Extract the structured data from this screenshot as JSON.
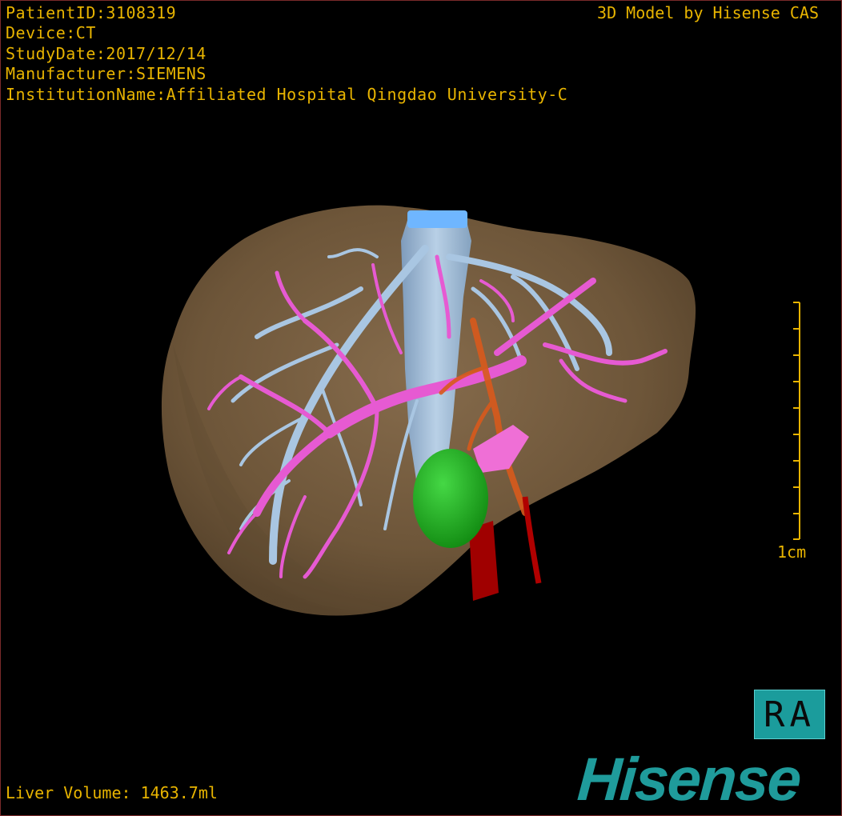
{
  "overlay": {
    "patient_id": "PatientID:3108319",
    "device": "Device:CT",
    "study_date": "StudyDate:2017/12/14",
    "manufacturer": "Manufacturer:SIEMENS",
    "institution": "InstitutionName:Affiliated Hospital Qingdao University-C",
    "brand_text": "3D Model by Hisense CAS",
    "liver_volume": "Liver Volume: 1463.7ml"
  },
  "scale": {
    "label": "1cm"
  },
  "orientation": {
    "label": "RA"
  },
  "logo": {
    "text": "Hisense"
  },
  "colors": {
    "overlay_text": "#e8b400",
    "liver": "#7b6142",
    "hepatic_vein": "#a9c6e2",
    "portal_vein": "#e65ad2",
    "artery": "#d85a1c",
    "aorta": "#a00000",
    "gallbladder": "#2bbd2b",
    "logo": "#1f9b9b",
    "badge": "#1b9c9c"
  }
}
